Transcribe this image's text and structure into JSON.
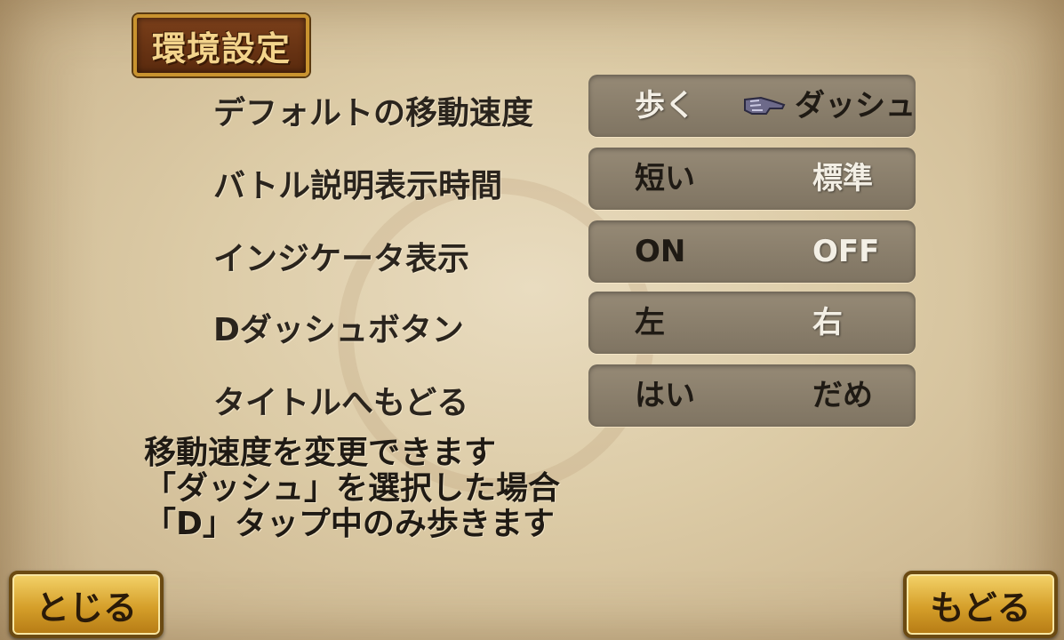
{
  "title": "環境設定",
  "settings": [
    {
      "label": "デフォルトの移動速度",
      "option_a": "歩く",
      "option_b": "ダッシュ",
      "selected": "b"
    },
    {
      "label": "バトル説明表示時間",
      "option_a": "短い",
      "option_b": "標準",
      "selected": "a"
    },
    {
      "label": "インジケータ表示",
      "option_a": "ON",
      "option_b": "OFF",
      "selected": "a"
    },
    {
      "label": "Dダッシュボタン",
      "option_a": "左",
      "option_b": "右",
      "selected": "a"
    },
    {
      "label": "タイトルへもどる",
      "option_a": "はい",
      "option_b": "だめ",
      "selected": "b"
    }
  ],
  "help": {
    "line1": "移動速度を変更できます",
    "line2": "「ダッシュ」を選択した場合",
    "line3": "「D」タップ中のみ歩きます"
  },
  "buttons": {
    "close": "とじる",
    "back": "もどる"
  },
  "pointer_icon": "gauntlet-pointer-icon"
}
